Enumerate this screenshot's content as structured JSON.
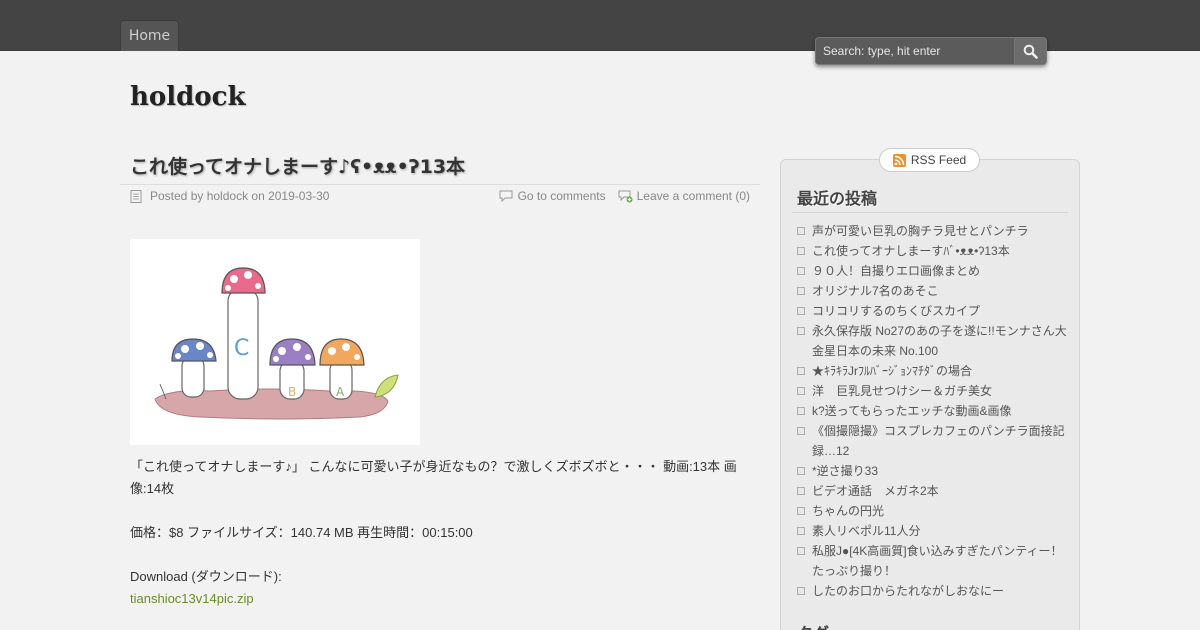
{
  "nav": {
    "home_label": "Home"
  },
  "search": {
    "placeholder": "Search: type, hit enter"
  },
  "site": {
    "title": "holdock"
  },
  "post": {
    "title": "これ使ってオナしまーす♪ʕ•ᴥᴥ•ʔ13本",
    "meta_posted": "Posted by holdock on 2019-03-30",
    "go_to_comments": "Go to comments",
    "leave_comment": "Leave a comment (0)",
    "body_line1": "「これ使ってオナしまーす♪」 こんなに可愛い子が身近なもの？で激しくズボズボと・・・ 動画:13本 画像:14枚",
    "body_line2": "価格：$8 ファイルサイズ：140.74 MB 再生時間：00:15:00",
    "download_label": "Download (ダウンロード):",
    "download_link": "tianshioc13v14pic.zip",
    "image_letters": [
      "C",
      "B",
      "A"
    ]
  },
  "sidebar": {
    "rss_label": "RSS Feed",
    "recent_heading": "最近の投稿",
    "recent_posts": [
      "声が可愛い巨乳の胸チラ見せとパンチラ",
      "これ使ってオナしまーすﾊﾞ•ᴥᴥ•ʔ13本",
      "９０人！自撮りエロ画像まとめ",
      "オリジナル7名のあそこ",
      "コリコリするのちくびスカイプ",
      "永久保存版 No27のあの子を遂に!!モンナさん大金星日本の未来 No.100",
      "★ｷﾗｷﾗJrﾌﾙﾊﾞｰｼﾞｮﾝﾏﾁﾀﾞの場合",
      "洋　巨乳見せつけシー＆ガチ美女",
      "k?送ってもらったエッチな動画&画像",
      "《個撮隠撮》コスプレカフェのパンチラ面接記録…12",
      "*逆さ撮り33",
      "ビデオ通話　メガネ2本",
      "ちゃんの円光",
      "素人リベポル11人分",
      "私服J●[4K高画質]食い込みすぎたパンティー！たっぷり撮り！",
      "したのお口からたれながしおなにー"
    ],
    "next_heading": "タグ"
  },
  "colors": {
    "topbar": "#444444",
    "link_green": "#6b8e23",
    "background": "#f2f2f2"
  }
}
